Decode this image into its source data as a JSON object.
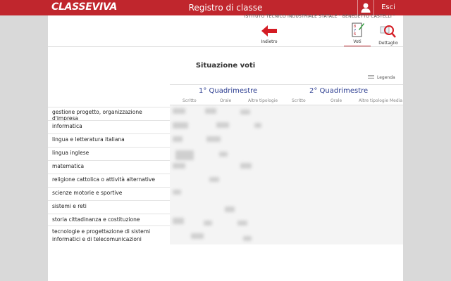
{
  "header": {
    "logo_text": "CLASSEVIVA",
    "title": "Registro di classe",
    "exit_label": "Esci",
    "brand_color": "#c0262d",
    "user_icon": "user-icon"
  },
  "school_name": "ISTITUTO TECNICO INDUSTRIALE STATALE \" BENEDETTO CASTELLI \"",
  "toolbar": {
    "back_label": "Indietro",
    "grades_label": "Voti",
    "detail_label": "Dettaglio"
  },
  "main": {
    "section_title": "Situazione voti",
    "legend_label": "Legenda",
    "periods": [
      "1° Quadrimestre",
      "2° Quadrimestre"
    ],
    "columns": [
      "Scritto",
      "Orale",
      "Altre tipologie",
      "Scritto",
      "Orale",
      "Altre tipologie",
      "Media"
    ],
    "subjects": [
      "gestione progetto, organizzazione d'impresa",
      "informatica",
      "lingua e letteratura italiana",
      "lingua inglese",
      "matematica",
      "religione cattolica o attività alternative",
      "scienze motorie e sportive",
      "sistemi e reti",
      "storia cittadinanza e costituzione",
      "tecnologie e progettazione di sistemi",
      "informatici e di telecomunicazioni"
    ]
  }
}
